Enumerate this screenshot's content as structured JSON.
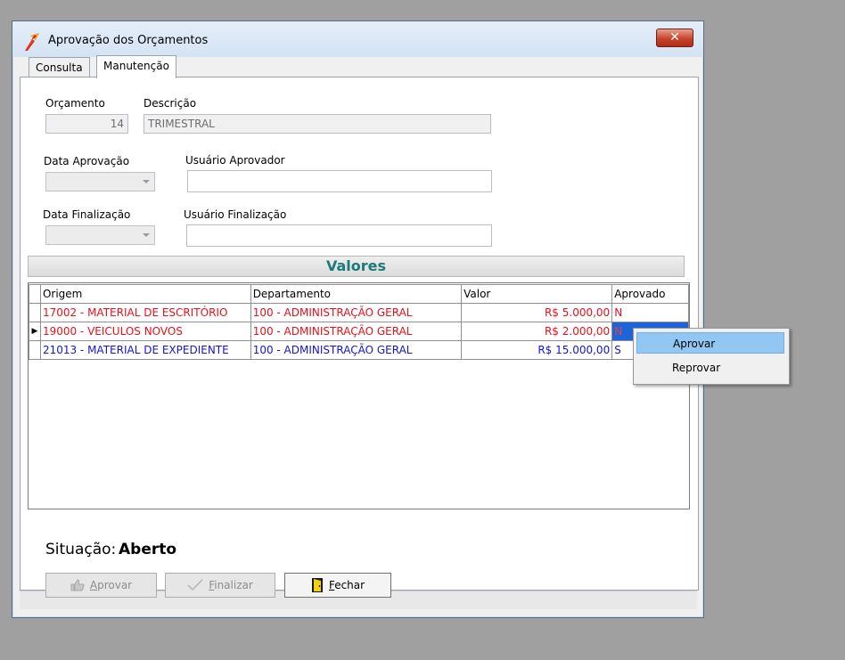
{
  "window": {
    "title": "Aprovação dos Orçamentos",
    "close_icon": "close-icon"
  },
  "tabs": [
    {
      "label": "Consulta",
      "active": false
    },
    {
      "label": "Manutenção",
      "active": true
    }
  ],
  "form": {
    "orcamento_label": "Orçamento",
    "orcamento_value": "14",
    "descricao_label": "Descrição",
    "descricao_value": "TRIMESTRAL",
    "data_aprovacao_label": "Data Aprovação",
    "usuario_aprovador_label": "Usuário Aprovador",
    "usuario_aprovador_value": "",
    "data_finalizacao_label": "Data Finalização",
    "usuario_finalizacao_label": "Usuário Finalização",
    "usuario_finalizacao_value": ""
  },
  "section": {
    "title": "Valores"
  },
  "grid": {
    "columns": [
      "Origem",
      "Departamento",
      "Valor",
      "Aprovado"
    ],
    "rows": [
      {
        "origem": "17002 - MATERIAL DE ESCRITÓRIO",
        "departamento": "100 - ADMINISTRAÇÃO GERAL",
        "valor": "R$ 5.000,00",
        "aprovado": "N",
        "color": "#e8101a"
      },
      {
        "origem": "19000 - VEICULOS NOVOS",
        "departamento": "100 - ADMINISTRAÇÃO GERAL",
        "valor": "R$ 2.000,00",
        "aprovado": "N",
        "color": "#e8101a",
        "current": true
      },
      {
        "origem": "21013 - MATERIAL DE EXPEDIENTE",
        "departamento": "100 - ADMINISTRAÇÃO GERAL",
        "valor": "R$ 15.000,00",
        "aprovado": "S",
        "color": "#1414d4"
      }
    ]
  },
  "status": {
    "label": "Situação:",
    "value": "Aberto"
  },
  "buttons": {
    "aprovar": {
      "pre": "",
      "hot": "A",
      "post": "provar"
    },
    "finalizar": {
      "pre": "",
      "hot": "F",
      "post": "inalizar"
    },
    "fechar": {
      "pre": "",
      "hot": "F",
      "post": "echar"
    }
  },
  "context_menu": {
    "items": [
      "Aprovar",
      "Reprovar"
    ]
  },
  "colors": {
    "accent": "#1b7a7a",
    "selection": "#1c64d8",
    "menu_highlight": "#92c7f4"
  }
}
